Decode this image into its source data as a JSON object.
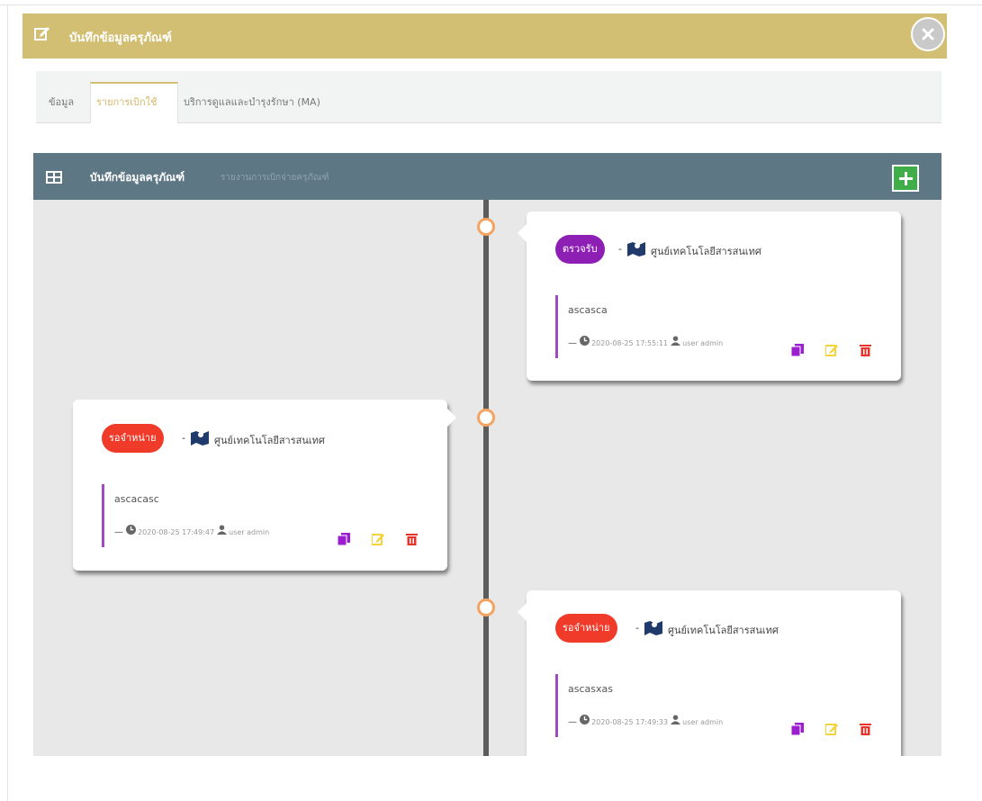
{
  "modal": {
    "title": "บันทึกข้อมูลครุภัณฑ์",
    "header_color": "#d2bf74"
  },
  "tabs": [
    {
      "label": "ข้อมูล",
      "active": false
    },
    {
      "label": "รายการเบิกใช้",
      "active": true
    },
    {
      "label": "บริการดูแลและบำรุงรักษา (MA)",
      "active": false
    }
  ],
  "panel": {
    "title": "บันทึกข้อมูลครุภัณฑ์",
    "subtitle": "รายงานการเบิกจ่ายครุภัณฑ์",
    "header_color": "#5e7785"
  },
  "timeline": [
    {
      "side": "right",
      "status": "ตรวจรับ",
      "status_color": "#8e1fb5",
      "separator": "-",
      "unit": "ศูนย์เทคโนโลยีสารสนเทศ",
      "note": "ascasca",
      "meta_prefix": "—",
      "datetime": "2020-08-25 17:55:11",
      "user": "user admin"
    },
    {
      "side": "left",
      "status": "รอจำหน่าย",
      "status_color": "#f03a2a",
      "separator": "-",
      "unit": "ศูนย์เทคโนโลยีสารสนเทศ",
      "note": "ascacasc",
      "meta_prefix": "—",
      "datetime": "2020-08-25 17:49:47",
      "user": "user admin"
    },
    {
      "side": "right",
      "status": "รอจำหน่าย",
      "status_color": "#f03a2a",
      "separator": "-",
      "unit": "ศูนย์เทคโนโลยีสารสนเทศ",
      "note": "ascasxas",
      "meta_prefix": "—",
      "datetime": "2020-08-25 17:49:33",
      "user": "user admin"
    }
  ],
  "icons": {
    "copy": "copy-icon",
    "edit": "edit-icon",
    "delete": "trash-icon",
    "clock": "clock-icon",
    "user": "user-icon",
    "map": "map-icon"
  },
  "colors": {
    "timeline_node": "#f4a460",
    "add_button": "#3fae49",
    "copy": "#9b1fcf",
    "edit": "#f5d33a",
    "delete": "#e8332a"
  }
}
